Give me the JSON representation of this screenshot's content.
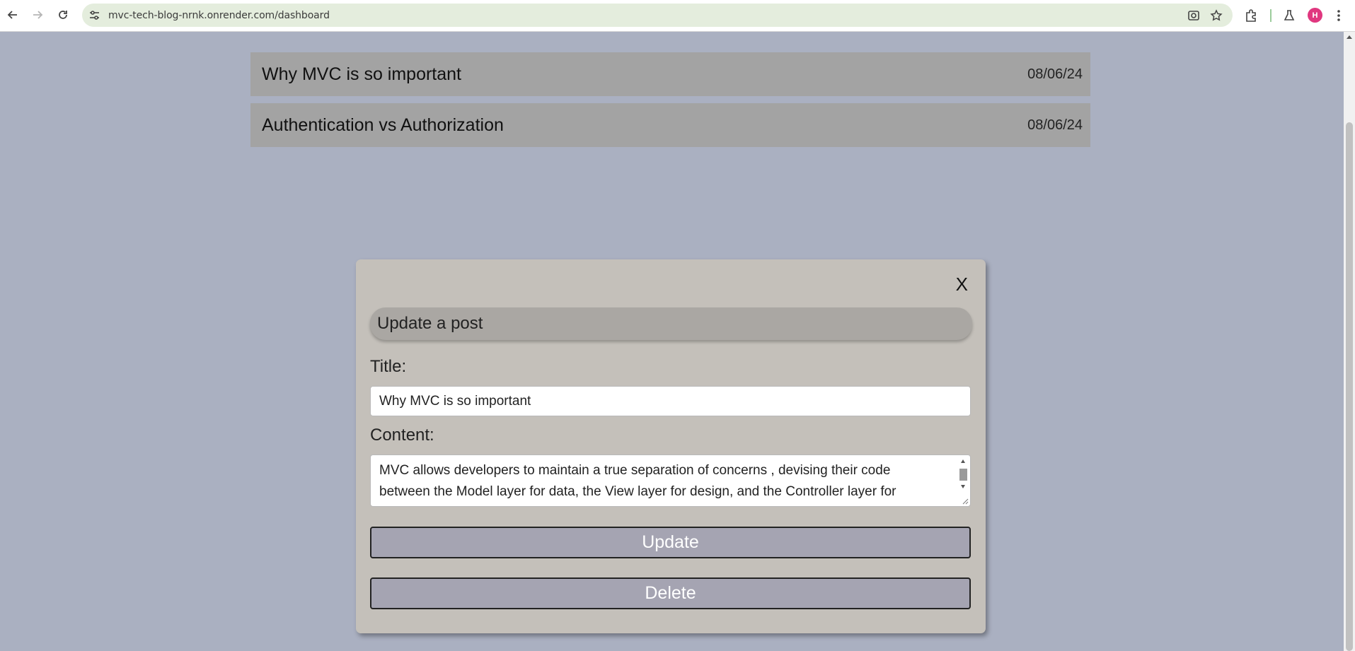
{
  "browser": {
    "url": "mvc-tech-blog-nrnk.onrender.com/dashboard",
    "profile_initial": "H",
    "icons": [
      "back-arrow-icon",
      "forward-arrow-icon",
      "reload-icon",
      "site-info-icon",
      "screenshot-lens-icon",
      "bookmark-star-icon",
      "extensions-puzzle-icon",
      "labs-flask-icon",
      "more-menu-icon"
    ]
  },
  "posts": [
    {
      "title": "Why MVC is so important",
      "date": "08/06/24"
    },
    {
      "title": "Authentication vs Authorization",
      "date": "08/06/24"
    }
  ],
  "modal": {
    "close_label": "X",
    "header": "Update a post",
    "title_label": "Title:",
    "title_value": "Why MVC is so important",
    "content_label": "Content:",
    "content_value": "MVC allows developers to maintain a true separation of concerns , devising their code between the Model layer for data, the View layer for design, and the Controller layer for",
    "update_label": "Update",
    "delete_label": "Delete"
  },
  "colors": {
    "page_bg": "#aab0c1",
    "post_row_bg": "#a3a3a3",
    "modal_bg": "#c4c0ba",
    "button_bg": "#a5a4b2",
    "omnibox_bg": "#e4eddd",
    "avatar_bg": "#e0377f"
  }
}
